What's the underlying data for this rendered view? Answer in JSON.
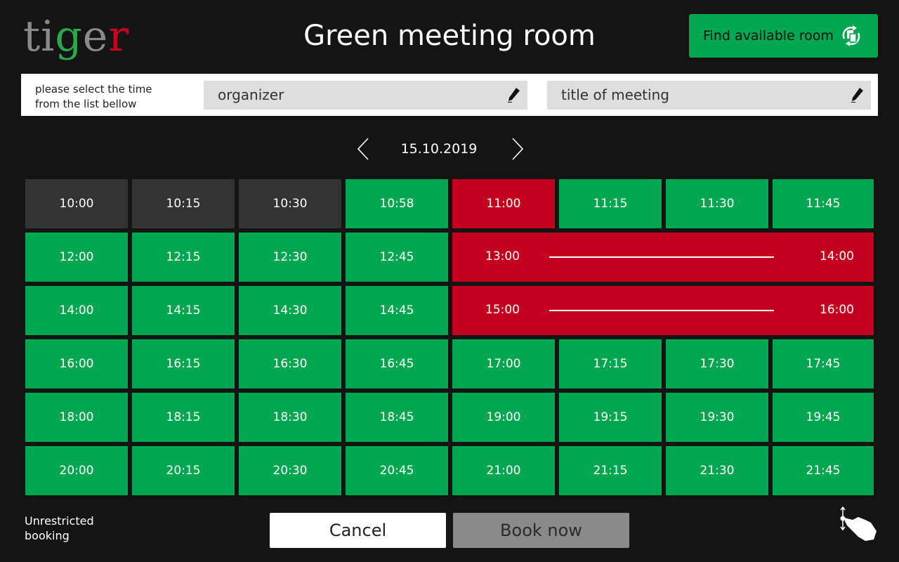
{
  "logo": {
    "p1": "ti",
    "p2": "g",
    "p3": "e",
    "p4": "r"
  },
  "title": "Green meeting room",
  "find_button": {
    "label": "Find available room",
    "icon": "room-swap-icon"
  },
  "form": {
    "hint_line1": "please select the time",
    "hint_line2": "from the list bellow",
    "organizer_placeholder": "organizer",
    "title_placeholder": "title of meeting"
  },
  "date": "15.10.2019",
  "colors": {
    "free": "#00a650",
    "booked": "#c3001d",
    "past": "#333333"
  },
  "slots": [
    {
      "time": "10:00",
      "status": "past"
    },
    {
      "time": "10:15",
      "status": "past"
    },
    {
      "time": "10:30",
      "status": "past"
    },
    {
      "time": "10:58",
      "status": "free"
    },
    {
      "time": "11:00",
      "status": "booked"
    },
    {
      "time": "11:15",
      "status": "free"
    },
    {
      "time": "11:30",
      "status": "free"
    },
    {
      "time": "11:45",
      "status": "free"
    },
    {
      "time": "12:00",
      "status": "free"
    },
    {
      "time": "12:15",
      "status": "free"
    },
    {
      "time": "12:30",
      "status": "free"
    },
    {
      "time": "12:45",
      "status": "free"
    },
    {
      "time": "14:00",
      "status": "free"
    },
    {
      "time": "14:15",
      "status": "free"
    },
    {
      "time": "14:30",
      "status": "free"
    },
    {
      "time": "14:45",
      "status": "free"
    },
    {
      "time": "16:00",
      "status": "free"
    },
    {
      "time": "16:15",
      "status": "free"
    },
    {
      "time": "16:30",
      "status": "free"
    },
    {
      "time": "16:45",
      "status": "free"
    },
    {
      "time": "17:00",
      "status": "free"
    },
    {
      "time": "17:15",
      "status": "free"
    },
    {
      "time": "17:30",
      "status": "free"
    },
    {
      "time": "17:45",
      "status": "free"
    },
    {
      "time": "18:00",
      "status": "free"
    },
    {
      "time": "18:15",
      "status": "free"
    },
    {
      "time": "18:30",
      "status": "free"
    },
    {
      "time": "18:45",
      "status": "free"
    },
    {
      "time": "19:00",
      "status": "free"
    },
    {
      "time": "19:15",
      "status": "free"
    },
    {
      "time": "19:30",
      "status": "free"
    },
    {
      "time": "19:45",
      "status": "free"
    },
    {
      "time": "20:00",
      "status": "free"
    },
    {
      "time": "20:15",
      "status": "free"
    },
    {
      "time": "20:30",
      "status": "free"
    },
    {
      "time": "20:45",
      "status": "free"
    },
    {
      "time": "21:00",
      "status": "free"
    },
    {
      "time": "21:15",
      "status": "free"
    },
    {
      "time": "21:30",
      "status": "free"
    },
    {
      "time": "21:45",
      "status": "free"
    }
  ],
  "bookings": [
    {
      "from": "13:00",
      "to": "14:00",
      "status": "booked"
    },
    {
      "from": "15:00",
      "to": "16:00",
      "status": "booked"
    }
  ],
  "footer": {
    "note_line1": "Unrestricted",
    "note_line2": "booking",
    "cancel_label": "Cancel",
    "book_label": "Book now",
    "gesture_icon": "touch-scroll-icon"
  }
}
